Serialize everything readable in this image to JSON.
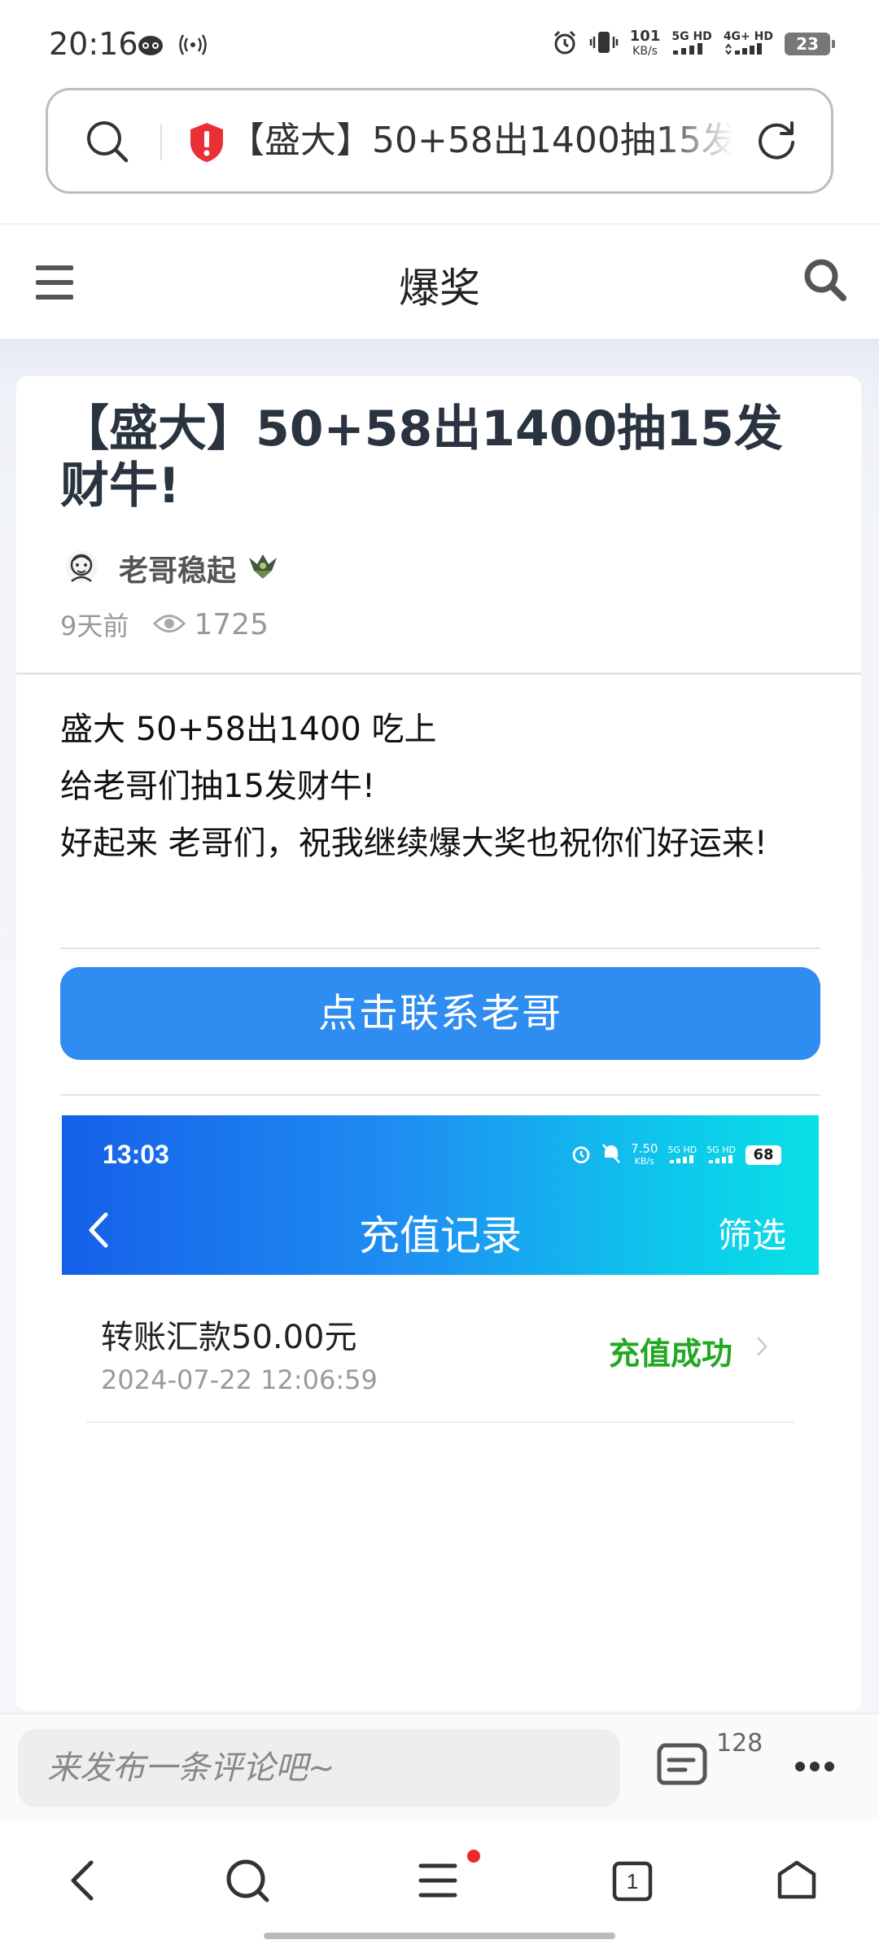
{
  "status_bar": {
    "time": "20:16",
    "speed_value": "101",
    "speed_unit": "KB/s",
    "net1": "5G HD",
    "net2": "4G+ HD",
    "battery": "23"
  },
  "url_bar": {
    "text": "【盛大】50+58出1400抽15发财牛!"
  },
  "header": {
    "title": "爆奖"
  },
  "post": {
    "title": "【盛大】50+58出1400抽15发财牛!",
    "author": "老哥稳起",
    "time_ago": "9天前",
    "views": "1725",
    "paragraphs": [
      "盛大 50+58出1400 吃上",
      "给老哥们抽15发财牛!",
      "好起来 老哥们，祝我继续爆大奖也祝你们好运来!"
    ],
    "contact_button": "点击联系老哥"
  },
  "embedded_screenshot": {
    "time": "13:03",
    "speed_value": "7.50",
    "speed_unit": "KB/s",
    "net1": "5G HD",
    "net2": "5G HD",
    "battery": "68",
    "title": "充值记录",
    "filter": "筛选",
    "record": {
      "title": "转账汇款50.00元",
      "date": "2024-07-22 12:06:59",
      "status": "充值成功"
    }
  },
  "comment_bar": {
    "placeholder": "来发布一条评论吧~",
    "count": "128"
  },
  "nav": {
    "tabs_count": "1"
  },
  "colors": {
    "accent_button": "#2f8cf0",
    "success_green": "#22a822",
    "notification_dot": "#ea2a2a"
  }
}
